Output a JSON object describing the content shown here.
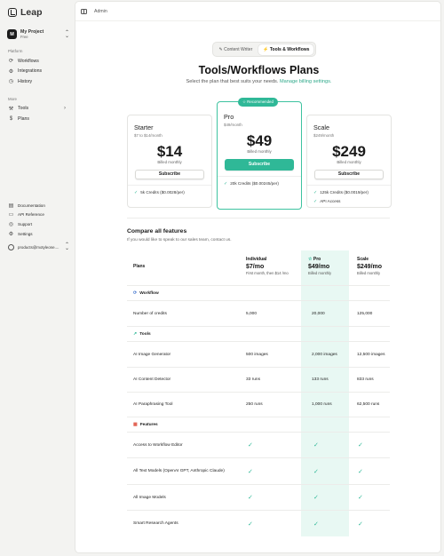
{
  "app": {
    "name": "Leap"
  },
  "sidebar": {
    "project": {
      "initial": "M",
      "name": "My Project",
      "plan": "Free"
    },
    "platform_label": "Platform",
    "platform_items": [
      {
        "label": "Workflows",
        "icon": "workflow-icon"
      },
      {
        "label": "Integrations",
        "icon": "integrations-icon"
      },
      {
        "label": "History",
        "icon": "history-icon"
      }
    ],
    "more_label": "More",
    "more_items": [
      {
        "label": "Tools",
        "icon": "wrench-icon"
      },
      {
        "label": "Plans",
        "icon": "dollar-icon"
      }
    ],
    "bottom_items": [
      {
        "label": "Documentation",
        "icon": "book-icon"
      },
      {
        "label": "API Reference",
        "icon": "api-icon"
      },
      {
        "label": "Support",
        "icon": "support-icon"
      },
      {
        "label": "Settings",
        "icon": "gear-icon"
      }
    ],
    "user_email": "products@motyleone...."
  },
  "topbar": {
    "breadcrumb": "Admin"
  },
  "tabs": [
    {
      "label": "Content Writer",
      "active": false
    },
    {
      "label": "Tools & Workflows",
      "active": true
    }
  ],
  "page": {
    "title": "Tools/Workflows Plans",
    "subtitle_text": "Select the plan that best suits your needs.",
    "subtitle_link": "Manage billing settings."
  },
  "cards": [
    {
      "name": "Starter",
      "subline": "$7 to $14/month",
      "price": "$14",
      "billed": "Billed monthly",
      "button": "Subscribe",
      "features": [
        "5k Credits ($0.0028/per)"
      ]
    },
    {
      "name": "Pro",
      "subline": "$49/month",
      "price": "$49",
      "billed": "Billed monthly",
      "button": "Subscribe",
      "badge": "Recommended",
      "features": [
        "20k Credits ($0.00245/per)"
      ]
    },
    {
      "name": "Scale",
      "subline": "$249/month",
      "price": "$249",
      "billed": "Billed monthly",
      "button": "Subscribe",
      "features": [
        "125k Credits ($0.0019/per)",
        "API Access"
      ]
    }
  ],
  "compare": {
    "title": "Compare all features",
    "subtitle": "If you would like to speak to our sales team, contact us.",
    "plans_label": "Plans",
    "columns": [
      {
        "name": "Individual",
        "price": "$7/mo",
        "note": "First month, then $14 /mo"
      },
      {
        "name": "Pro",
        "price": "$49/mo",
        "note": "Billed monthly"
      },
      {
        "name": "Scale",
        "price": "$249/mo",
        "note": "Billed monthly"
      }
    ],
    "sections": [
      {
        "name": "Workflow",
        "rows": [
          {
            "label": "Number of credits",
            "values": [
              "5,000",
              "20,000",
              "125,000"
            ]
          }
        ]
      },
      {
        "name": "Tools",
        "rows": [
          {
            "label": "AI Image Generator",
            "values": [
              "500 images",
              "2,000 images",
              "12,500 images"
            ]
          },
          {
            "label": "AI Content Detector",
            "values": [
              "33 runs",
              "133 runs",
              "833 runs"
            ]
          },
          {
            "label": "AI Paraphrasing Tool",
            "values": [
              "250 runs",
              "1,000 runs",
              "62,500 runs"
            ]
          }
        ]
      },
      {
        "name": "Features",
        "rows": [
          {
            "label": "Access to Workflow Editor",
            "values": [
              "✓",
              "✓",
              "✓"
            ]
          },
          {
            "label": "All Text Models (OpenAI GPT, Anthropic Claude)",
            "values": [
              "✓",
              "✓",
              "✓"
            ]
          },
          {
            "label": "All Image Models",
            "values": [
              "✓",
              "✓",
              "✓"
            ]
          },
          {
            "label": "Smart Research Agents",
            "values": [
              "✓",
              "✓",
              "✓"
            ]
          }
        ]
      }
    ]
  },
  "colors": {
    "accent": "#2fb897",
    "pro_column": "#e8f8f3",
    "sidebar_bg": "#f3f3f1"
  }
}
